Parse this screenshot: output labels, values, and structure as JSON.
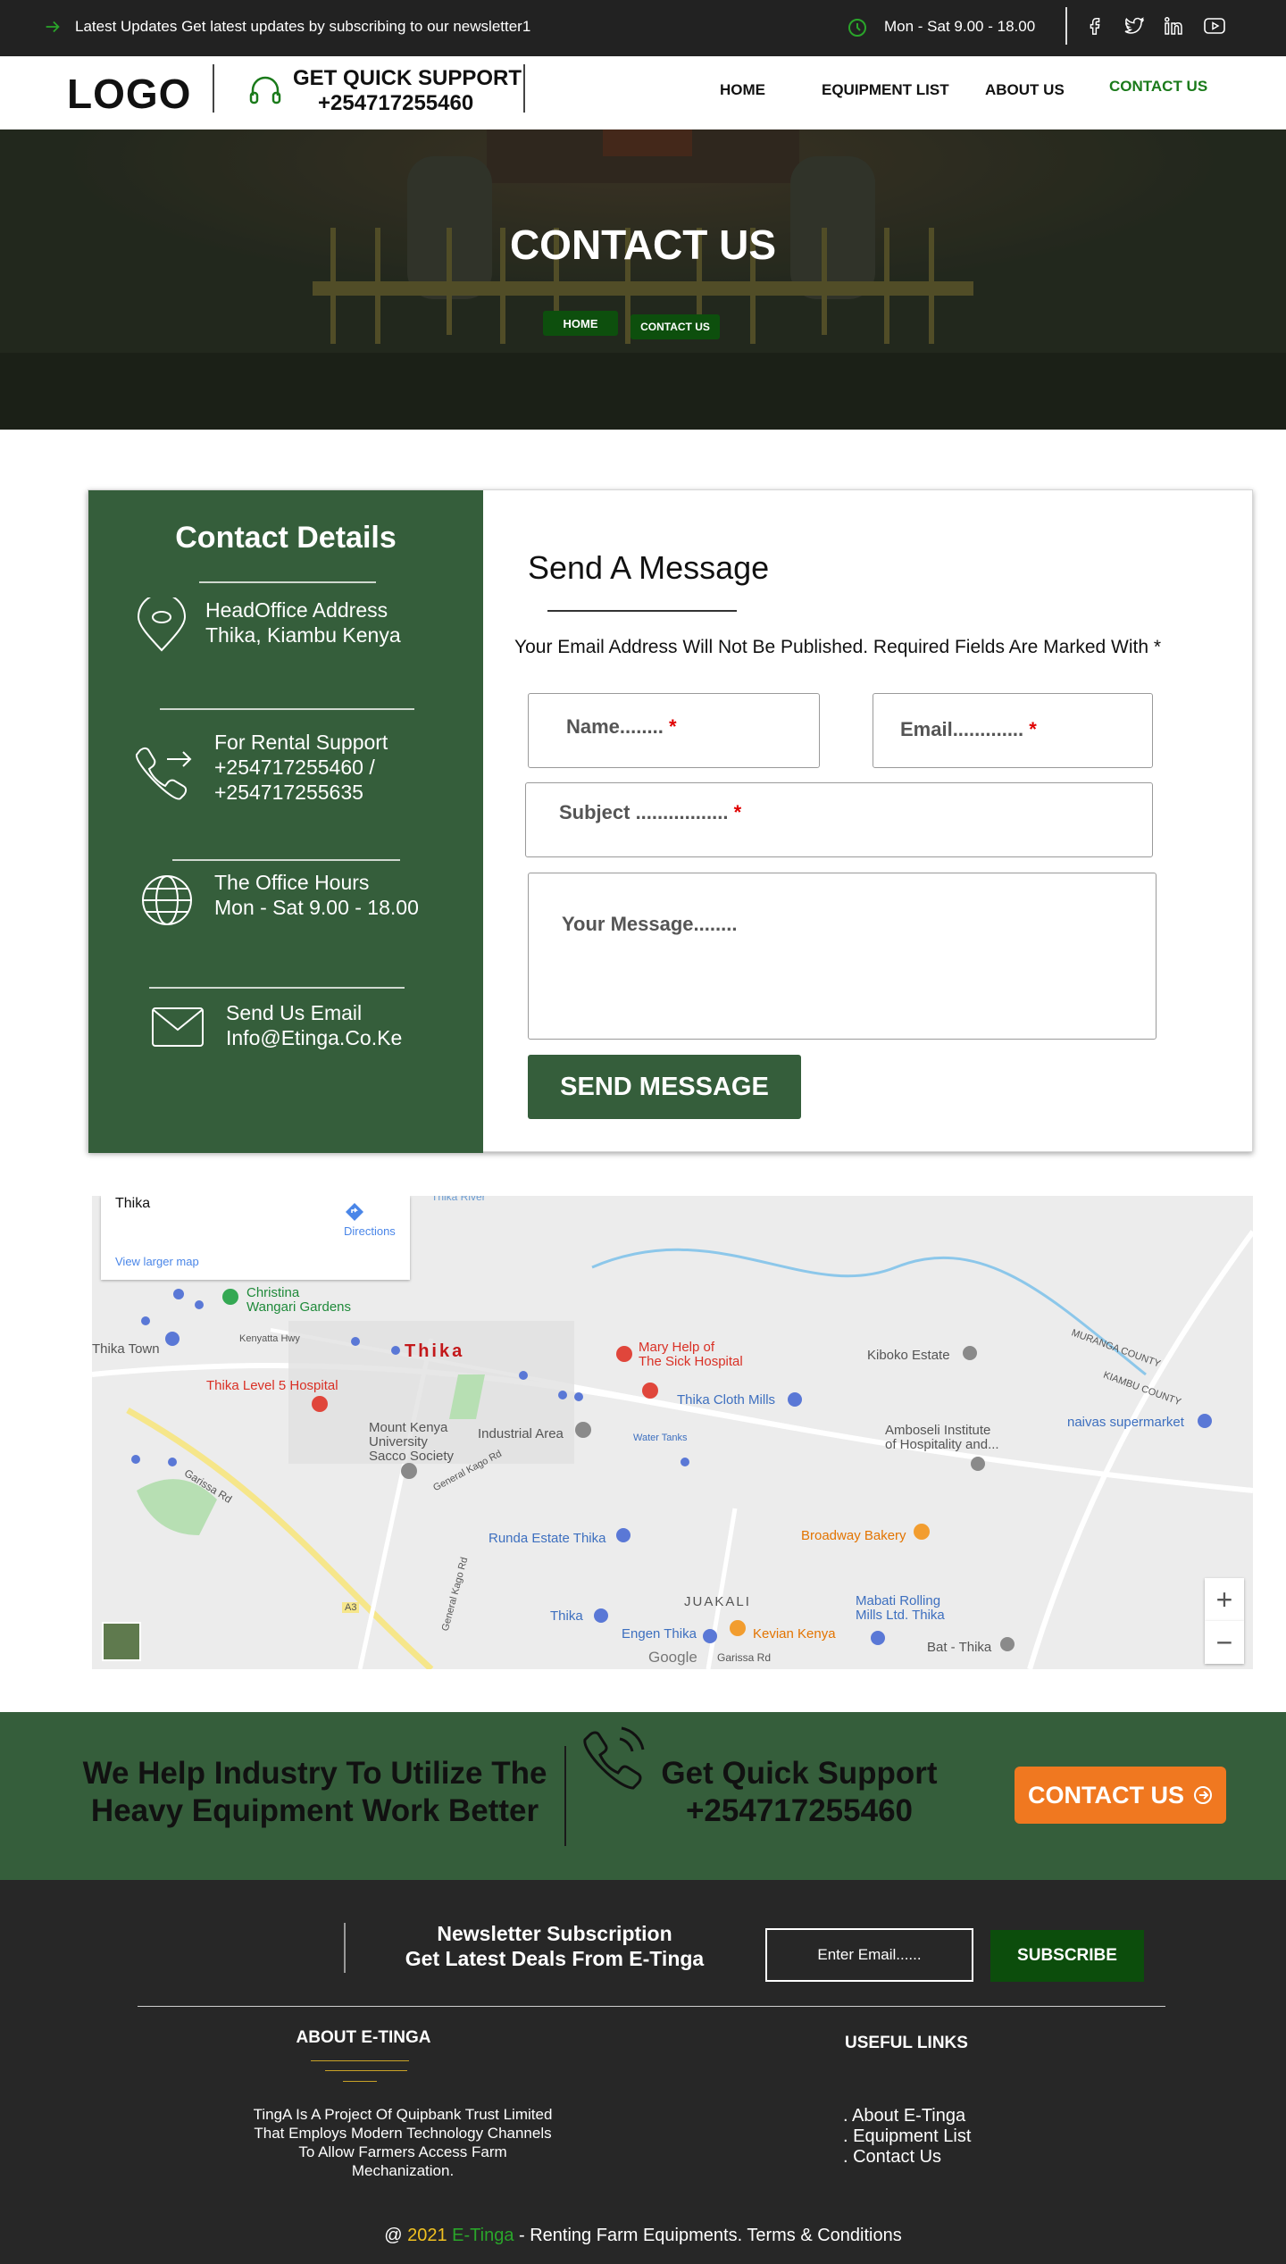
{
  "topbar": {
    "news": "Latest Updates Get latest updates by subscribing to our newsletter1",
    "hours": "Mon - Sat 9.00 - 18.00",
    "social_icons": [
      "facebook-icon",
      "twitter-icon",
      "linkedin-icon",
      "youtube-icon"
    ]
  },
  "header": {
    "logo": "LOGO",
    "support_title": "GET QUICK SUPPORT",
    "support_phone": "+254717255460",
    "nav": [
      "HOME",
      "EQUIPMENT LIST",
      "ABOUT US",
      "CONTACT US"
    ],
    "active_nav": "CONTACT US"
  },
  "hero": {
    "title": "CONTACT US",
    "breadcrumb": [
      "HOME",
      "CONTACT US"
    ]
  },
  "contact": {
    "title": "Contact Details",
    "address_label": "HeadOffice Address",
    "address": "Thika, Kiambu Kenya",
    "rental_label": "For Rental Support",
    "rental_phone1": "+254717255460 /",
    "rental_phone2": "+254717255635",
    "hours_label": "The Office Hours",
    "hours": "Mon - Sat 9.00 - 18.00",
    "email_label": "Send Us Email",
    "email": "Info@Etinga.Co.Ke"
  },
  "form": {
    "title": "Send A Message",
    "notice": "Your Email Address Will Not Be Published. Required Fields Are Marked With *",
    "name_placeholder": "Name........",
    "email_placeholder": "Email.............",
    "subject_placeholder": "Subject .................",
    "message_placeholder": "Your Message........",
    "required_mark": "*",
    "submit": "SEND MESSAGE"
  },
  "map": {
    "place": "Thika",
    "directions": "Directions",
    "larger_map": "View larger map",
    "labels": {
      "christina": "Christina\nWangari Gardens",
      "thika_town": "Thika Town",
      "thika_big": "Thika",
      "level5": "Thika Level 5 Hospital",
      "mary": "Mary Help of\nThe Sick Hospital",
      "kiboko": "Kiboko Estate",
      "cloth": "Thika Cloth Mills",
      "amboseli": "Amboseli Institute\nof Hospitality and...",
      "naivas": "naivas supermarket",
      "mount_kenya": "Mount Kenya\nUniversity\nSacco Society",
      "industrial": "Industrial Area",
      "water": "Water Tanks",
      "broadway": "Broadway Bakery",
      "runda": "Runda Estate Thika",
      "juakali": "JUAKALI",
      "mabati": "Mabati Rolling\nMills Ltd. Thika",
      "engen": "Engen Thika",
      "kevian": "Kevian Kenya",
      "bat": "Bat - Thika",
      "thika_small": "Thika",
      "google": "Google",
      "garissa1": "Garissa Rd",
      "garissa2": "Garissa Rd",
      "kenyatta": "Kenyatta Hwy",
      "general_kago": "General Kago Rd",
      "general_kago2": "General Kago Rd",
      "muranga": "MURANGA COUNTY",
      "kiambu": "KIAMBU COUNTY",
      "river": "Thika River",
      "a3": "A3"
    },
    "zoom_in": "+",
    "zoom_out": "−"
  },
  "cta": {
    "left": "We Help Industry To Utilize The Heavy Equipment Work Better",
    "mid_title": "Get Quick Support",
    "mid_phone": "+254717255460",
    "button": "CONTACT US"
  },
  "footer": {
    "news_title1": "Newsletter Subscription",
    "news_title2": "Get Latest Deals From E-Tinga",
    "email_placeholder": "Enter Email......",
    "subscribe": "SUBSCRIBE",
    "about_title": "ABOUT E-TINGA",
    "about_text": "TingA Is A Project Of Quipbank Trust Limited That Employs Modern Technology Channels To Allow Farmers Access Farm Mechanization.",
    "links_title": "USEFUL LINKS",
    "links": [
      ".  About E-Tinga",
      ".  Equipment List",
      ".  Contact Us"
    ],
    "copy_prefix": "@ ",
    "copy_year": "2021",
    "copy_brand": " E-Tinga",
    "copy_suffix": " - Renting Farm Equipments. Terms & Conditions"
  },
  "colors": {
    "dark_green": "#355e3b",
    "accent_green": "#1a7a1a",
    "orange": "#f07820",
    "topbar": "#222222",
    "footer": "#272727"
  }
}
